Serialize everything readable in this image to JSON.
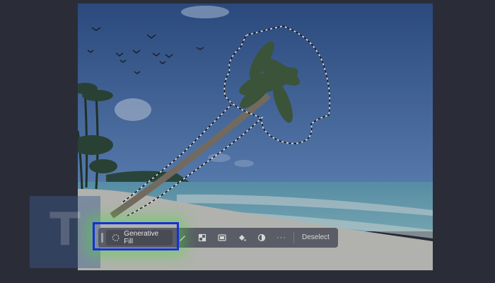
{
  "watermark": {
    "text": "T"
  },
  "toolbar": {
    "generative_fill_label": "Generative Fill",
    "deselect_label": "Deselect",
    "more_label": "···"
  },
  "colors": {
    "highlight_border": "#1530d8",
    "highlight_glow": "#46dc3c",
    "toolbar_bg": "#525660",
    "background": "#2a2d38"
  }
}
